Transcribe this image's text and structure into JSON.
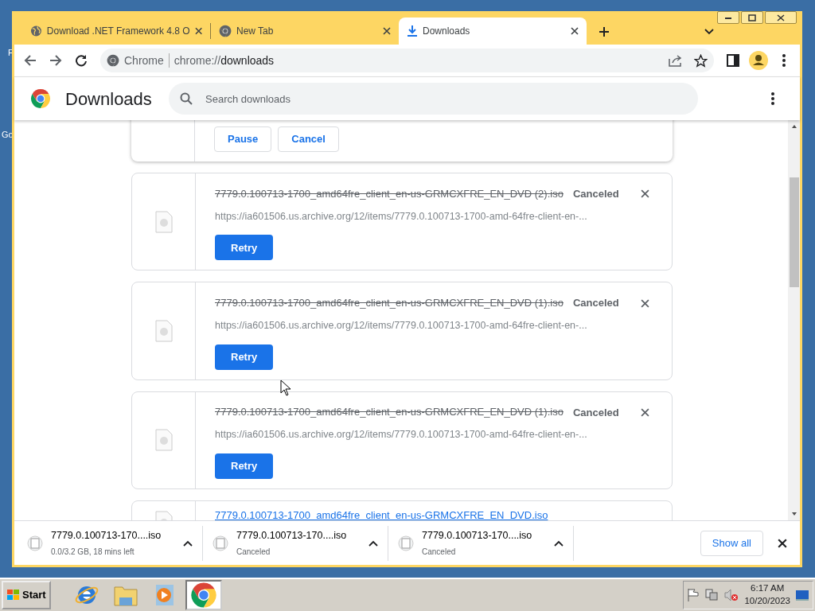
{
  "desktop_labels": [
    "F",
    "Go"
  ],
  "tabs": [
    {
      "title": "Download .NET Framework 4.8 O",
      "selected": false
    },
    {
      "title": "New Tab",
      "selected": false
    },
    {
      "title": "Downloads",
      "selected": true
    }
  ],
  "omnibox": {
    "chip": "Chrome",
    "scheme": "chrome://",
    "host": "downloads"
  },
  "page": {
    "title": "Downloads",
    "search": {
      "placeholder": "Search downloads"
    }
  },
  "downloads": [
    {
      "kind": "in_progress",
      "buttons": [
        "Pause",
        "Cancel"
      ]
    },
    {
      "kind": "canceled",
      "filename": "7779.0.100713-1700_amd64fre_client_en-us-GRMCXFRE_EN_DVD (2).iso",
      "status": "Canceled",
      "url": "https://ia601506.us.archive.org/12/items/7779.0.100713-1700-amd-64fre-client-en-...",
      "buttons": [
        "Retry"
      ]
    },
    {
      "kind": "canceled",
      "filename": "7779.0.100713-1700_amd64fre_client_en-us-GRMCXFRE_EN_DVD (1).iso",
      "status": "Canceled",
      "url": "https://ia601506.us.archive.org/12/items/7779.0.100713-1700-amd-64fre-client-en-...",
      "buttons": [
        "Retry"
      ]
    },
    {
      "kind": "canceled",
      "filename": "7779.0.100713-1700_amd64fre_client_en-us-GRMCXFRE_EN_DVD (1).iso",
      "status": "Canceled",
      "url": "https://ia601506.us.archive.org/12/items/7779.0.100713-1700-amd-64fre-client-en-...",
      "buttons": [
        "Retry"
      ]
    },
    {
      "kind": "complete",
      "filename": "7779.0.100713-1700_amd64fre_client_en-us-GRMCXFRE_EN_DVD.iso"
    }
  ],
  "shelf": {
    "items": [
      {
        "filename": "7779.0.100713-170....iso",
        "status": "0.0/3.2 GB, 18 mins left"
      },
      {
        "filename": "7779.0.100713-170....iso",
        "status": "Canceled"
      },
      {
        "filename": "7779.0.100713-170....iso",
        "status": "Canceled"
      }
    ],
    "show_all": "Show all"
  },
  "taskbar": {
    "start": "Start",
    "apps": [
      {
        "selected": false
      },
      {
        "selected": false
      },
      {
        "selected": false
      },
      {
        "selected": true
      }
    ],
    "time": "6:17 AM",
    "date": "10/20/2023"
  }
}
